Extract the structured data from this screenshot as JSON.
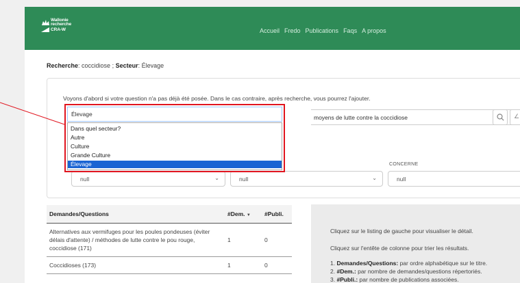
{
  "logo": {
    "line1": "Wallonie",
    "line2": "recherche",
    "line3": "CRA-W"
  },
  "nav": {
    "items": [
      "Accueil",
      "Fredo",
      "Publications",
      "Faqs",
      "A propos"
    ]
  },
  "breadcrumb": {
    "search_label": "Recherche",
    "search_value": "coccidiose ;",
    "sector_label": "Secteur",
    "sector_value": "Élevage"
  },
  "search": {
    "intro": "Voyons d'abord si votre question n'a pas déjà été posée. Dans le cas contraire, après recherche, vous pourrez l'ajouter.",
    "query_value": "moyens de lutte contre la coccidiose",
    "extra_button_glyph": "∠",
    "sector_select": {
      "value": "Élevage",
      "options": [
        "Dans quel secteur?",
        "Autre",
        "Culture",
        "Grande Culture",
        "Élevage"
      ],
      "selected_index": 4
    }
  },
  "filters": {
    "concerne_label": "CONCERNE",
    "select1_value": "null",
    "select2_value": "null",
    "select3_value": "null"
  },
  "results": {
    "headers": {
      "title": "Demandes/Questions",
      "dem": "#Dem.",
      "dem_sort": "▼",
      "publi": "#Publi."
    },
    "rows": [
      {
        "title": "Alternatives aux vermifuges pour les poules pondeuses (éviter délais d'attente) / méthodes de lutte contre le pou rouge, coccidiose (171)",
        "dem": "1",
        "publi": "0"
      },
      {
        "title": "Coccidioses (173)",
        "dem": "1",
        "publi": "0"
      }
    ]
  },
  "help": {
    "line1": "Cliquez sur le listing de gauche pour visualiser le détail.",
    "line2": "Cliquez sur l'entête de colonne pour trier les résultats.",
    "items": [
      {
        "num": "1.",
        "bold": "Demandes/Questions:",
        "text": " par ordre alphabétique sur le titre."
      },
      {
        "num": "2.",
        "bold": "#Dem.:",
        "text": " par nombre de demandes/questions répertoriés."
      },
      {
        "num": "3.",
        "bold": "#Publi.:",
        "text": " par nombre de publications associées."
      }
    ]
  },
  "colors": {
    "navbar": "#2e8b57",
    "highlight": "#e0141e",
    "selected_option": "#1a64d3"
  }
}
